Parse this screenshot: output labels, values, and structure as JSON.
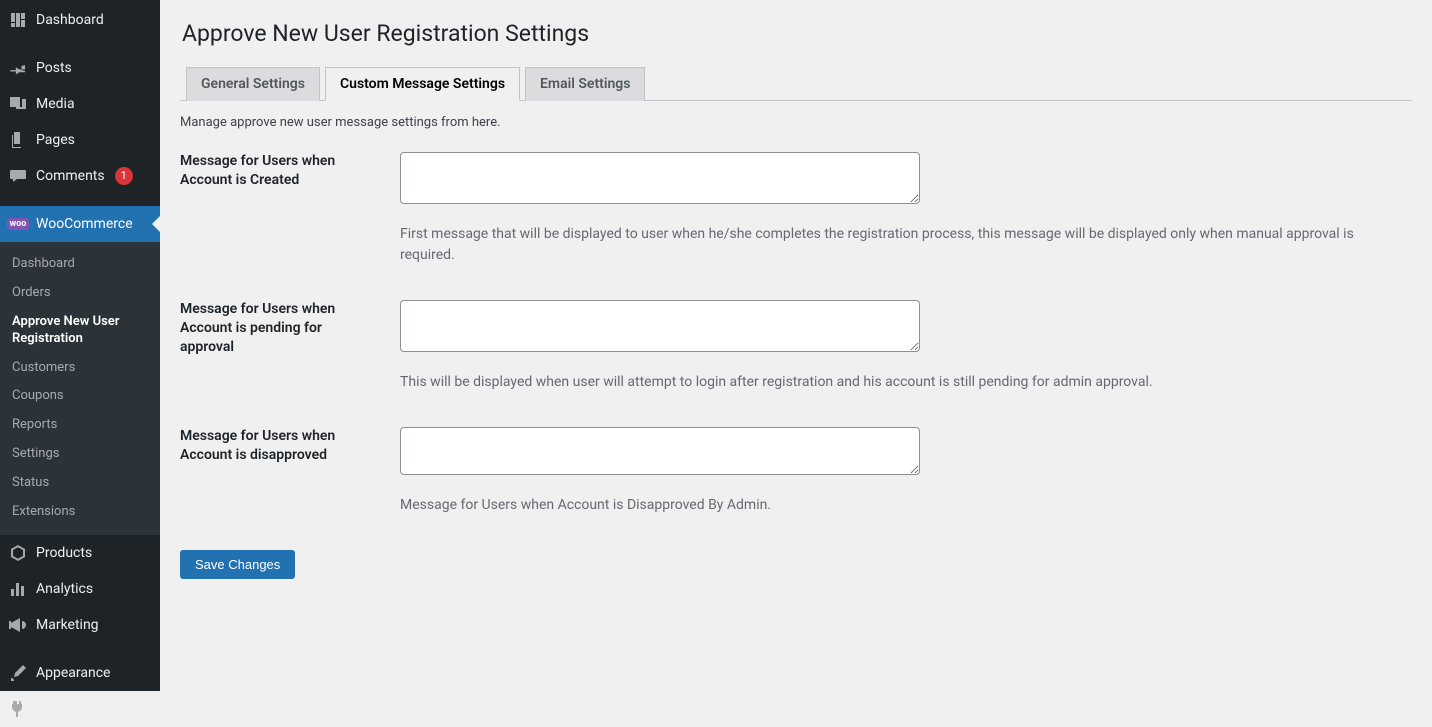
{
  "sidebar": {
    "items": [
      {
        "label": "Dashboard"
      },
      {
        "label": "Posts"
      },
      {
        "label": "Media"
      },
      {
        "label": "Pages"
      },
      {
        "label": "Comments",
        "badge": "1"
      },
      {
        "label": "WooCommerce"
      },
      {
        "label": "Products"
      },
      {
        "label": "Analytics"
      },
      {
        "label": "Marketing"
      },
      {
        "label": "Appearance"
      },
      {
        "label": "Plugins"
      }
    ],
    "woo_submenu": [
      {
        "label": "Dashboard"
      },
      {
        "label": "Orders"
      },
      {
        "label": "Approve New User Registration"
      },
      {
        "label": "Customers"
      },
      {
        "label": "Coupons"
      },
      {
        "label": "Reports"
      },
      {
        "label": "Settings"
      },
      {
        "label": "Status"
      },
      {
        "label": "Extensions"
      }
    ]
  },
  "page": {
    "title": "Approve New User Registration Settings",
    "tabs": [
      {
        "label": "General Settings"
      },
      {
        "label": "Custom Message Settings"
      },
      {
        "label": "Email Settings"
      }
    ],
    "tab_desc": "Manage approve new user message settings from here.",
    "fields": [
      {
        "label": "Message for Users when Account is Created",
        "value": "",
        "helper": "First message that will be displayed to user when he/she completes the registration process, this message will be displayed only when manual approval is required."
      },
      {
        "label": "Message for Users when Account is pending for approval",
        "value": "",
        "helper": "This will be displayed when user will attempt to login after registration and his account is still pending for admin approval."
      },
      {
        "label": "Message for Users when Account is disapproved",
        "value": "",
        "helper": "Message for Users when Account is Disapproved By Admin."
      }
    ],
    "save_label": "Save Changes"
  }
}
